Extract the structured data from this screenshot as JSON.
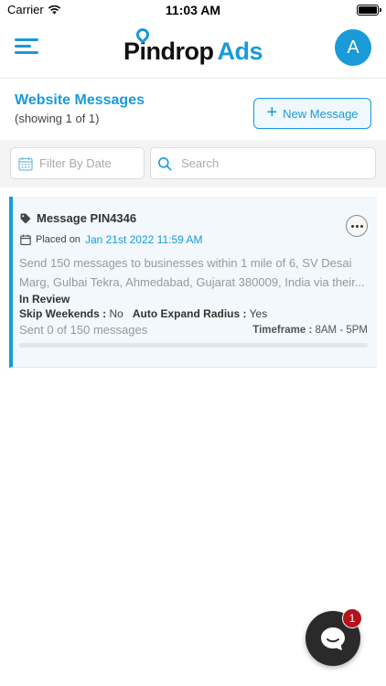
{
  "status_bar": {
    "carrier": "Carrier",
    "time": "11:03 AM",
    "battery_level": 1.0
  },
  "header": {
    "logo_part1": "Pindrop",
    "logo_part2": "Ads",
    "avatar_initial": "A",
    "accent_color": "#1a9ad9"
  },
  "page": {
    "title": "Website Messages",
    "subtitle": "(showing 1 of 1)",
    "new_message_label": "New Message"
  },
  "filters": {
    "date_placeholder": "Filter By Date",
    "search_placeholder": "Search"
  },
  "message": {
    "title": "Message PIN4346",
    "placed_label": "Placed on",
    "placed_date": "Jan 21st 2022 11:59 AM",
    "description": "Send 150 messages to businesses within 1 mile of 6, SV Desai Marg, Gulbai Tekra, Ahmedabad, Gujarat 380009, India via their...",
    "status": "In Review",
    "skip_weekends_label": "Skip Weekends :",
    "skip_weekends_value": "No",
    "auto_expand_label": "Auto Expand Radius :",
    "auto_expand_value": "Yes",
    "sent_text": "Sent 0 of 150 messages",
    "sent_count": 0,
    "total_count": 150,
    "timeframe_label": "Timeframe :",
    "timeframe_value": "8AM - 5PM"
  },
  "chat": {
    "badge_count": "1"
  }
}
